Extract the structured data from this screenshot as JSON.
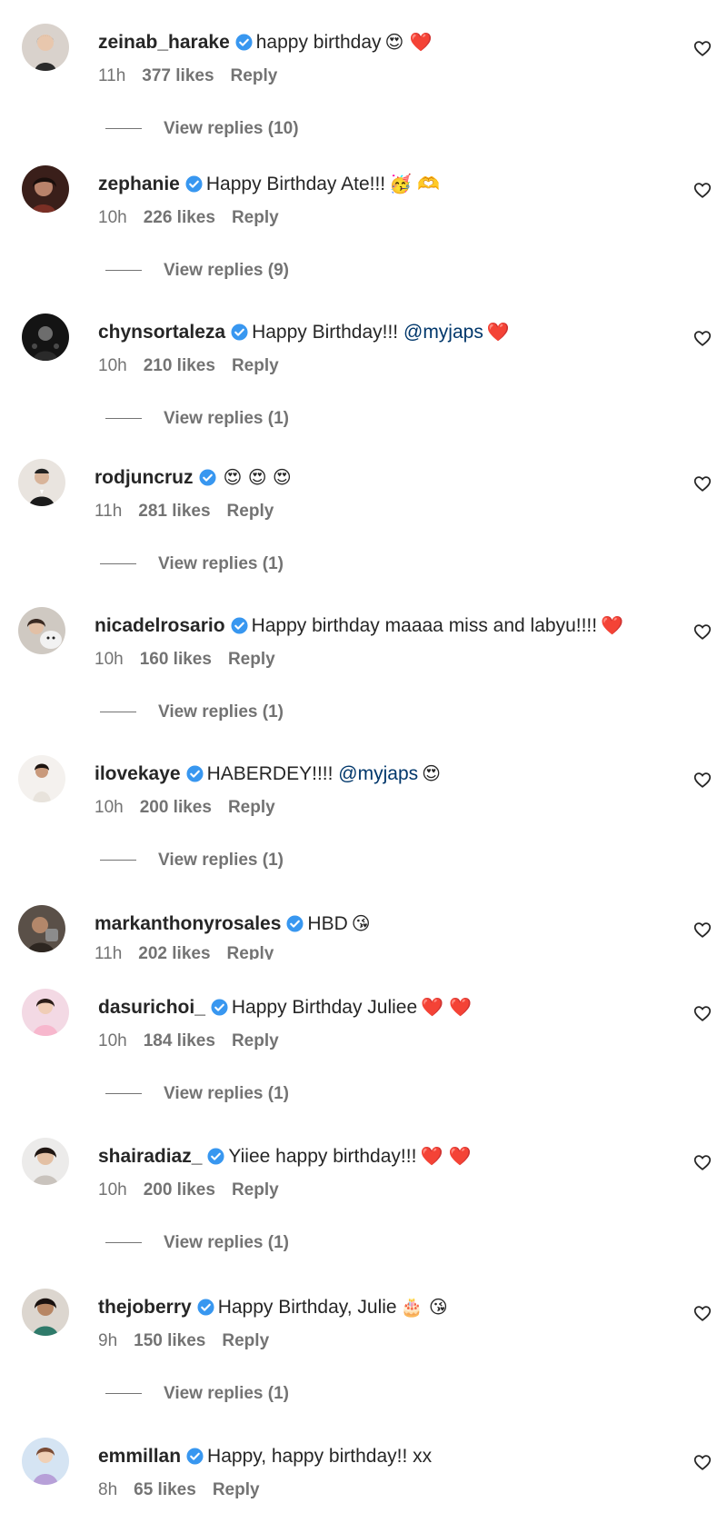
{
  "ui": {
    "verified_color": "#3897f0",
    "text_color": "#262626",
    "muted_color": "#737373",
    "mention_color": "#00376b"
  },
  "comments": [
    {
      "username": "zeinab_harake",
      "text": "happy birthday",
      "mention": "",
      "emoji": "😍 ❤️",
      "time": "11h",
      "likes": "377 likes",
      "reply": "Reply",
      "view_replies": "View replies (10)",
      "avatar_icon": "avatar-zeinab"
    },
    {
      "username": "zephanie",
      "text": "Happy Birthday Ate!!!",
      "mention": "",
      "emoji": "🥳 🫶",
      "time": "10h",
      "likes": "226 likes",
      "reply": "Reply",
      "view_replies": "View replies (9)",
      "avatar_icon": "avatar-zephanie"
    },
    {
      "username": "chynsortaleza",
      "text": "Happy Birthday!!!",
      "mention": "@myjaps",
      "emoji": "❤️",
      "time": "10h",
      "likes": "210 likes",
      "reply": "Reply",
      "view_replies": "View replies (1)",
      "avatar_icon": "avatar-chyn"
    },
    {
      "username": "rodjuncruz",
      "text": "",
      "mention": "",
      "emoji": "😍 😍 😍",
      "time": "11h",
      "likes": "281 likes",
      "reply": "Reply",
      "view_replies": "View replies (1)",
      "avatar_icon": "avatar-rodjun"
    },
    {
      "username": "nicadelrosario",
      "text": "Happy birthday maaaa miss and labyu!!!!",
      "mention": "",
      "emoji": "❤️",
      "time": "10h",
      "likes": "160 likes",
      "reply": "Reply",
      "view_replies": "View replies (1)",
      "avatar_icon": "avatar-nica"
    },
    {
      "username": "ilovekaye",
      "text": "HABERDEY!!!!",
      "mention": "@myjaps",
      "emoji": "😍",
      "time": "10h",
      "likes": "200 likes",
      "reply": "Reply",
      "view_replies": "View replies (1)",
      "avatar_icon": "avatar-kaye"
    },
    {
      "username": "markanthonyrosales",
      "text": "HBD",
      "mention": "",
      "emoji": "😘",
      "time": "11h",
      "likes": "202 likes",
      "reply": "Reply",
      "view_replies": "",
      "avatar_icon": "avatar-mark"
    },
    {
      "username": "dasurichoi_",
      "text": "Happy Birthday Juliee",
      "mention": "",
      "emoji": "❤️ ❤️",
      "time": "10h",
      "likes": "184 likes",
      "reply": "Reply",
      "view_replies": "View replies (1)",
      "avatar_icon": "avatar-dasuri"
    },
    {
      "username": "shairadiaz_",
      "text": "Yiiee happy birthday!!!",
      "mention": "",
      "emoji": "❤️ ❤️",
      "time": "10h",
      "likes": "200 likes",
      "reply": "Reply",
      "view_replies": "View replies (1)",
      "avatar_icon": "avatar-shaira"
    },
    {
      "username": "thejoberry",
      "text": "Happy Birthday, Julie",
      "mention": "",
      "emoji": "🎂 😘",
      "time": "9h",
      "likes": "150 likes",
      "reply": "Reply",
      "view_replies": "View replies (1)",
      "avatar_icon": "avatar-jo"
    },
    {
      "username": "emmillan",
      "text": "Happy, happy birthday!! xx",
      "mention": "",
      "emoji": "",
      "time": "8h",
      "likes": "65 likes",
      "reply": "Reply",
      "view_replies": "",
      "avatar_icon": "avatar-emmillan"
    }
  ]
}
